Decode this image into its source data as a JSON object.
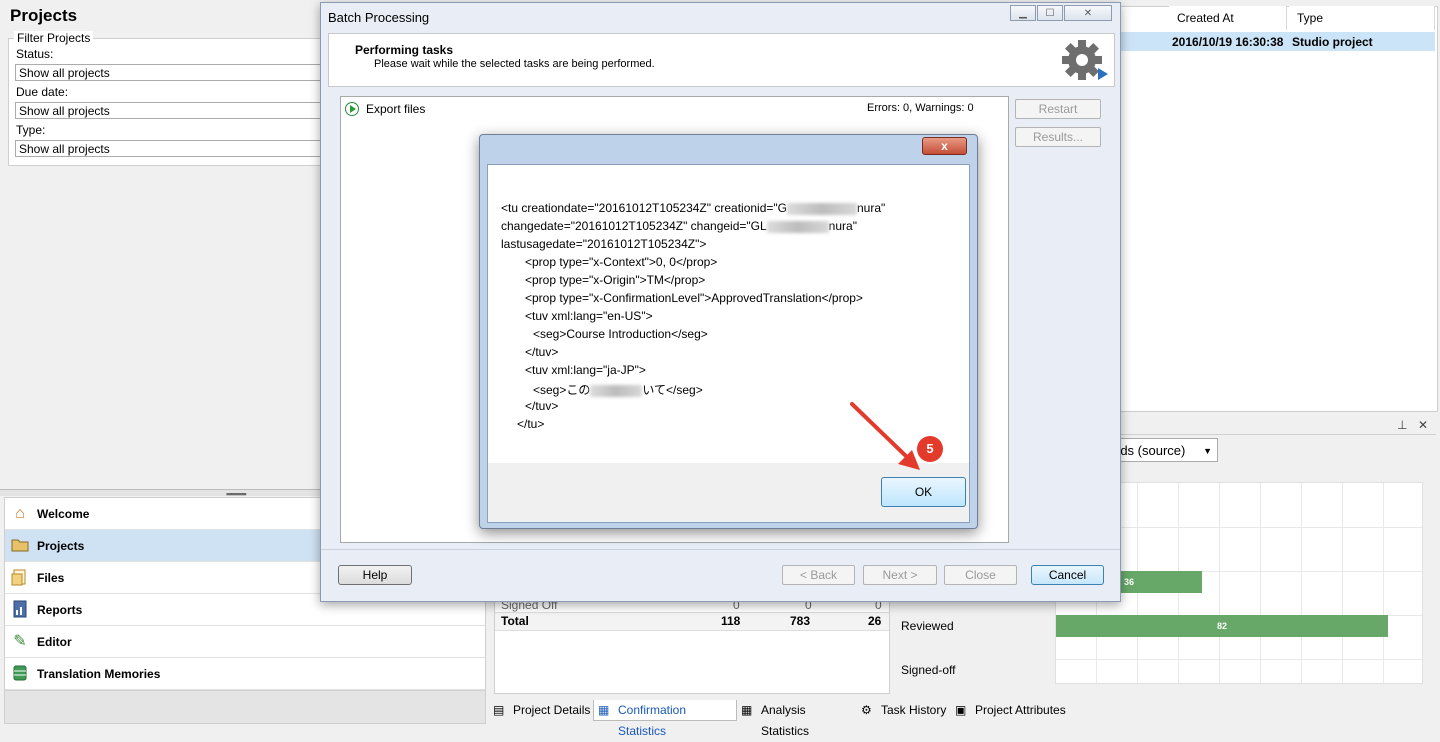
{
  "left_panel": {
    "title": "Projects",
    "filter": {
      "legend": "Filter Projects",
      "status_label": "Status:",
      "status_value": "Show all projects",
      "due_label": "Due date:",
      "due_value": "Show all projects",
      "type_label": "Type:",
      "type_value": "Show all projects"
    },
    "nav": [
      {
        "label": "Welcome",
        "icon": "home-icon"
      },
      {
        "label": "Projects",
        "icon": "folder-icon"
      },
      {
        "label": "Files",
        "icon": "files-icon"
      },
      {
        "label": "Reports",
        "icon": "reports-icon"
      },
      {
        "label": "Editor",
        "icon": "pencil-icon"
      },
      {
        "label": "Translation Memories",
        "icon": "database-icon"
      }
    ]
  },
  "grid": {
    "headers": [
      "Created At",
      "Type"
    ],
    "row": {
      "created": "2016/10/19 16:30:38",
      "type": "Studio project"
    }
  },
  "chart": {
    "dropdown_text": "rds (source)",
    "categories": [
      "Reviewed",
      "Signed-off"
    ],
    "bars": [
      {
        "label": "36",
        "value": 36
      },
      {
        "label": "82",
        "value": 82
      }
    ],
    "bar_color": "#67a868"
  },
  "stats": {
    "partial_row": {
      "label": "Signed Off",
      "v1": "0",
      "v2": "0",
      "v3": "0"
    },
    "total_row": {
      "label": "Total",
      "v1": "118",
      "v2": "783",
      "v3": "26"
    }
  },
  "tabs": [
    "Project Details",
    "Confirmation Statistics",
    "Analysis Statistics",
    "Task History",
    "Project Attributes"
  ],
  "batch_dialog": {
    "title": "Batch Processing",
    "heading": "Performing tasks",
    "subheading": "Please wait while the selected tasks are being performed.",
    "task_name": "Export files",
    "task_status": "Errors: 0, Warnings: 0",
    "side_buttons": [
      "Restart",
      "Results..."
    ],
    "footer_buttons": {
      "help": "Help",
      "back": "< Back",
      "next": "Next >",
      "close": "Close",
      "cancel": "Cancel"
    }
  },
  "popup": {
    "close_symbol": "x",
    "lines": [
      "<tu creationdate=\"20161012T105234Z\" creationid=\"G",
      "nura\"",
      "changedate=\"20161012T105234Z\" changeid=\"GL",
      "nura\"",
      "lastusagedate=\"20161012T105234Z\">",
      "<prop type=\"x-Context\">0, 0</prop>",
      "<prop type=\"x-Origin\">TM</prop>",
      "<prop type=\"x-ConfirmationLevel\">ApprovedTranslation</prop>",
      "<tuv xml:lang=\"en-US\">",
      "<seg>Course Introduction</seg>",
      "</tuv>",
      "<tuv xml:lang=\"ja-JP\">",
      "<seg>この",
      "いて</seg>",
      "</tuv>",
      "</tu>"
    ],
    "ok_label": "OK",
    "step_badge": "5",
    "accent": "#e33a2c"
  }
}
